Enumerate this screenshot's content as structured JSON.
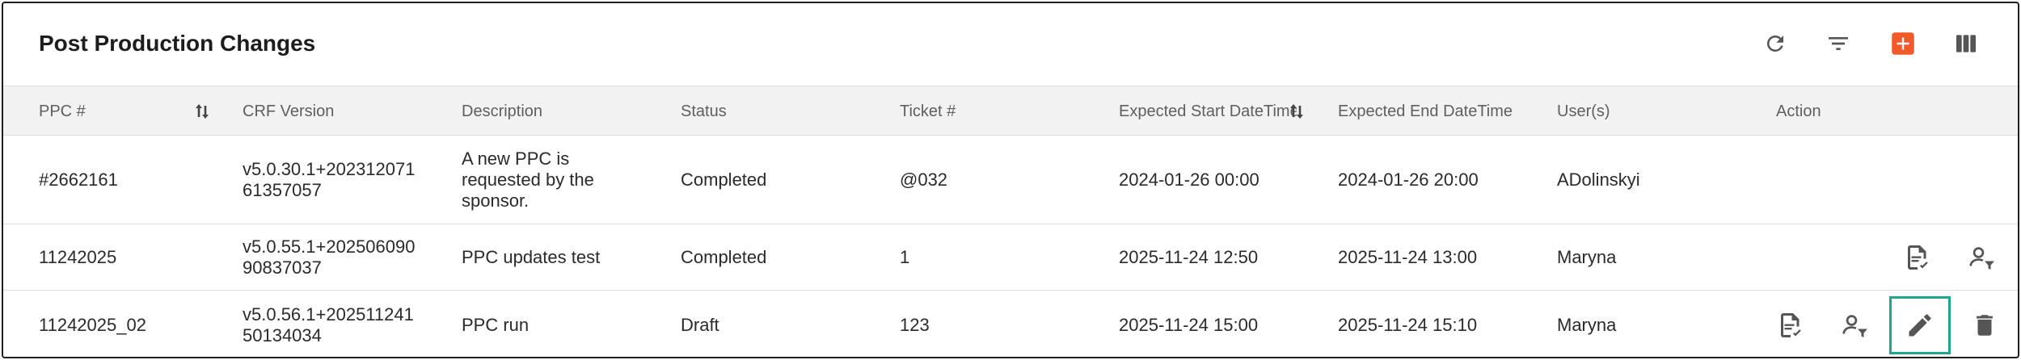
{
  "header": {
    "title": "Post Production Changes"
  },
  "colors": {
    "accent": "#f15a29",
    "focus_border": "#20a58e",
    "icon": "#555555"
  },
  "toolbar": {
    "icons": [
      "refresh-icon",
      "filter-icon",
      "add-icon",
      "columns-icon"
    ]
  },
  "columns": [
    "PPC #",
    "CRF Version",
    "Description",
    "Status",
    "Ticket #",
    "Expected Start DateTime",
    "Expected End DateTime",
    "User(s)",
    "Action"
  ],
  "rows": [
    {
      "ppc": "#2662161",
      "crf_line1": "v5.0.30.1+202312071",
      "crf_line2": "61357057",
      "description": "A new PPC is requested by the sponsor.",
      "status": "Completed",
      "ticket": "@032",
      "start": "2024-01-26 00:00",
      "end": "2024-01-26 20:00",
      "users": "ADolinskyi",
      "actions": []
    },
    {
      "ppc": "11242025",
      "crf_line1": "v5.0.55.1+202506090",
      "crf_line2": "90837037",
      "description": "PPC updates test",
      "status": "Completed",
      "ticket": "1",
      "start": "2025-11-24 12:50",
      "end": "2025-11-24 13:00",
      "users": "Maryna",
      "actions": [
        "approve-document-icon",
        "assign-user-icon"
      ]
    },
    {
      "ppc": "11242025_02",
      "crf_line1": "v5.0.56.1+202511241",
      "crf_line2": "50134034",
      "description": "PPC run",
      "status": "Draft",
      "ticket": "123",
      "start": "2025-11-24 15:00",
      "end": "2025-11-24 15:10",
      "users": "Maryna",
      "actions": [
        "approve-document-icon",
        "assign-user-icon",
        "edit-icon",
        "delete-icon"
      ]
    }
  ]
}
